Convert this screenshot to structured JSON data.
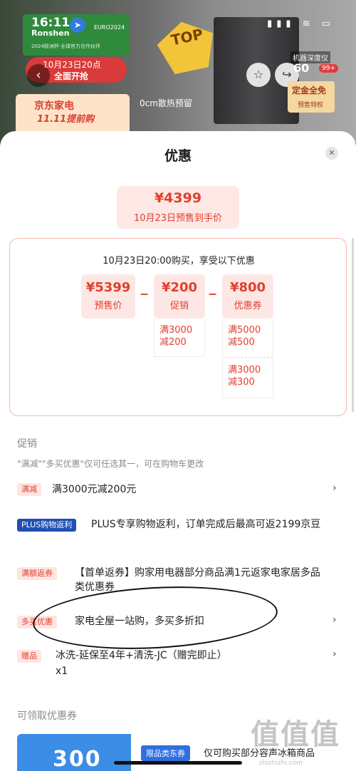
{
  "colors": {
    "accent_red": "#e0402f",
    "tag_blue": "#1f4fb3",
    "sheet_bg": "#ffffff"
  },
  "status_bar": {
    "time": "16:11",
    "icons": "▮▮▮ ≋ ▭"
  },
  "banner": {
    "brand": "Ronshen",
    "euro_badge": "EURO2024",
    "partner_text": "2024欧洲杯·全球官方合作伙伴",
    "sale_date": "10月23日20点",
    "sale_start": "全面开抢",
    "jd_title": "京东家电",
    "jd_sub": "11.11提前购",
    "top_badge": "TOP",
    "heat_note": "0cm散热预留",
    "depth_label": "机器深度仪",
    "depth_value": "60",
    "badge_count": "99+",
    "deposit_title": "定金全免",
    "deposit_sub": "预售特权"
  },
  "sheet": {
    "title": "优惠",
    "final_price": "¥4399",
    "final_label": "10月23日预售到手价",
    "calc_heading": "10月23日20:00购买，享受以下优惠",
    "presale": {
      "amount": "¥5399",
      "label": "预售价"
    },
    "discount": {
      "amount": "¥200",
      "label": "促销",
      "details": [
        "满3000\n减200"
      ]
    },
    "coupon": {
      "amount": "¥800",
      "label": "优惠券",
      "details": [
        "满5000\n减500",
        "满3000\n减300"
      ]
    },
    "operator": "−"
  },
  "promotions": {
    "section_label": "促销",
    "note": "\"满减\"\"多买优惠\"仅可任选其一，可在购物车更改",
    "items": [
      {
        "tag": "满减",
        "text": "满3000元减200元"
      },
      {
        "tag": "PLUS购物返利",
        "text": "PLUS专享购物返利，订单完成后最高可返2199京豆"
      },
      {
        "tag": "满额返券",
        "text": "【首单返券】购家用电器部分商品满1元返家电家居多品类优惠券"
      },
      {
        "tag": "多买优惠",
        "text": "家电全屋一站购，多买多折扣"
      },
      {
        "tag": "赠品",
        "text": "冰洗-延保至4年+清洗-JC（赠完即止）",
        "qty": "x1"
      }
    ]
  },
  "coupons": {
    "section_label": "可领取优惠券",
    "first": {
      "value": "300",
      "tag": "限品类东券",
      "desc": "仅可购买部分容声冰箱商品"
    }
  },
  "watermark": {
    "logo": "值值值",
    "url": "zhizhizhi.com"
  }
}
